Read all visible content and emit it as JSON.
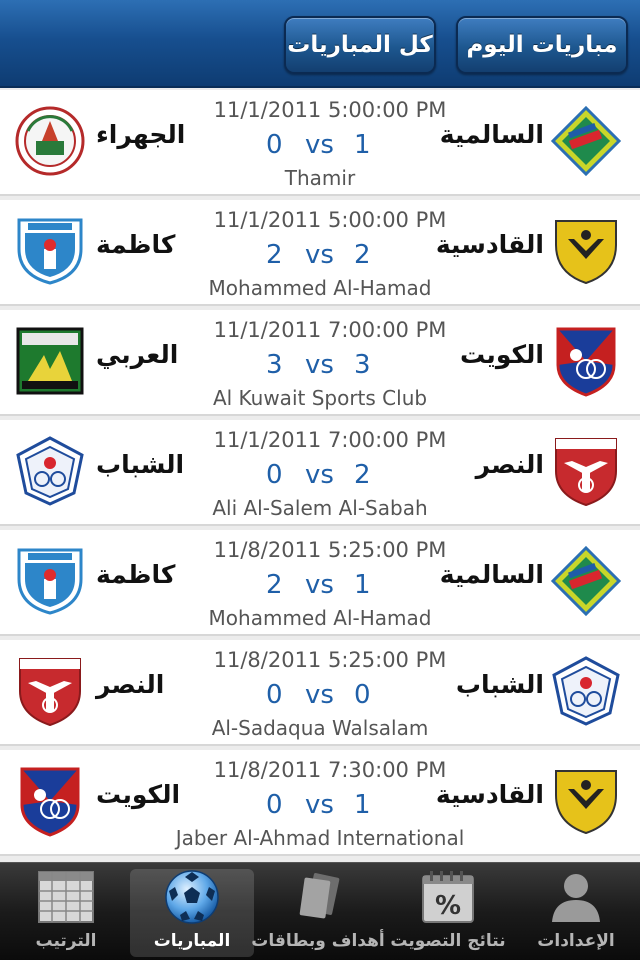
{
  "header": {
    "all_matches_label": "كل المباريات",
    "today_matches_label": "مباريات اليوم"
  },
  "matches": [
    {
      "date": "11/1/2011 5:00:00 PM",
      "home": "السالمية",
      "away": "الجهراء",
      "home_score": "1",
      "away_score": "0",
      "vs": "vs",
      "stadium": "Thamir",
      "home_logo": "salmiya-logo",
      "away_logo": "jahra-logo"
    },
    {
      "date": "11/1/2011 5:00:00 PM",
      "home": "القادسية",
      "away": "كاظمة",
      "home_score": "2",
      "away_score": "2",
      "vs": "vs",
      "stadium": "Mohammed Al-Hamad",
      "home_logo": "qadsia-logo",
      "away_logo": "kazma-logo"
    },
    {
      "date": "11/1/2011 7:00:00 PM",
      "home": "الكويت",
      "away": "العربي",
      "home_score": "3",
      "away_score": "3",
      "vs": "vs",
      "stadium": "Al Kuwait Sports Club",
      "home_logo": "kuwait-logo",
      "away_logo": "arabi-logo"
    },
    {
      "date": "11/1/2011 7:00:00 PM",
      "home": "النصر",
      "away": "الشباب",
      "home_score": "2",
      "away_score": "0",
      "vs": "vs",
      "stadium": "Ali Al-Salem Al-Sabah",
      "home_logo": "nasr-logo",
      "away_logo": "shabab-logo"
    },
    {
      "date": "11/8/2011 5:25:00 PM",
      "home": "السالمية",
      "away": "كاظمة",
      "home_score": "1",
      "away_score": "2",
      "vs": "vs",
      "stadium": "Mohammed Al-Hamad",
      "home_logo": "salmiya-logo",
      "away_logo": "kazma-logo"
    },
    {
      "date": "11/8/2011 5:25:00 PM",
      "home": "الشباب",
      "away": "النصر",
      "home_score": "0",
      "away_score": "0",
      "vs": "vs",
      "stadium": "Al-Sadaqua Walsalam",
      "home_logo": "shabab-logo",
      "away_logo": "nasr-logo"
    },
    {
      "date": "11/8/2011 7:30:00 PM",
      "home": "القادسية",
      "away": "الكويت",
      "home_score": "1",
      "away_score": "0",
      "vs": "vs",
      "stadium": "Jaber Al-Ahmad International",
      "home_logo": "qadsia-logo",
      "away_logo": "kuwait-logo"
    }
  ],
  "tabs": [
    {
      "label": "الترتيب",
      "icon": "table-grid-icon"
    },
    {
      "label": "المباريات",
      "icon": "soccer-ball-icon",
      "active": true
    },
    {
      "label": "أهداف وبطاقات",
      "icon": "cards-icon"
    },
    {
      "label": "نتائج التصويت",
      "icon": "percent-calendar-icon"
    },
    {
      "label": "الإعدادات",
      "icon": "user-silhouette-icon"
    }
  ],
  "colors": {
    "header_blue": "#174f8f",
    "score_blue": "#1f5fa8"
  }
}
